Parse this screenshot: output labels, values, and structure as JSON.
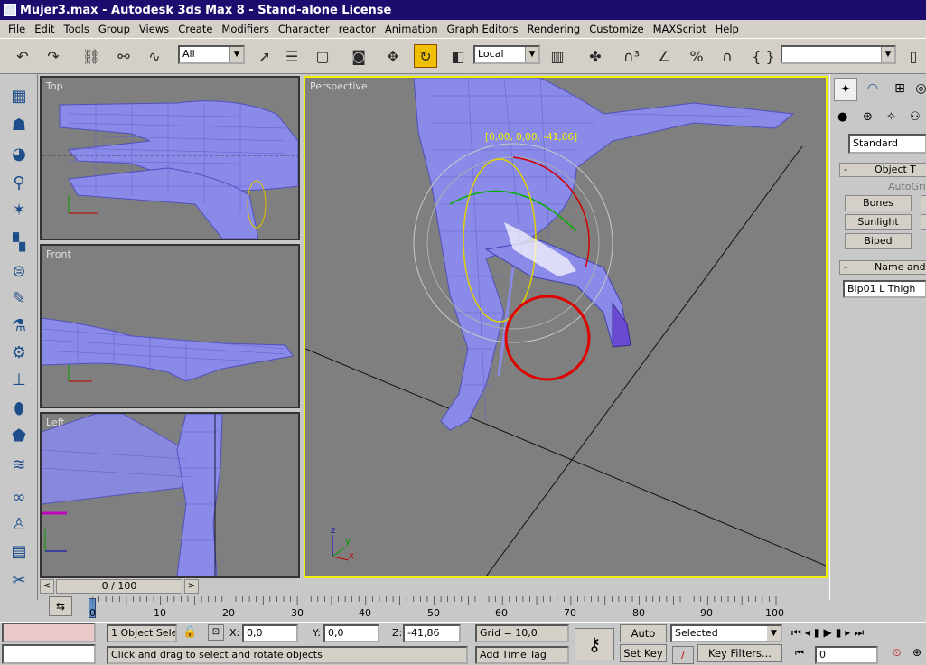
{
  "window": {
    "title": "Mujer3.max - Autodesk 3ds Max 8  - Stand-alone License"
  },
  "menu": [
    "File",
    "Edit",
    "Tools",
    "Group",
    "Views",
    "Create",
    "Modifiers",
    "Character",
    "reactor",
    "Animation",
    "Graph Editors",
    "Rendering",
    "Customize",
    "MAXScript",
    "Help"
  ],
  "toolbar": {
    "selection_filter": "All",
    "coord_system": "Local",
    "named_selection": ""
  },
  "viewports": {
    "top": "Top",
    "front": "Front",
    "left": "Left",
    "perspective": "Perspective",
    "coord_readout": "[0,00, 0,00, -41,86]",
    "axes": {
      "x": "x",
      "y": "y",
      "z": "z"
    }
  },
  "command_panel": {
    "category": "Standard",
    "rollout_object_type": "Object T",
    "autogrid": "AutoGric",
    "btn_bones": "Bones",
    "btn_sunlight": "Sunlight",
    "btn_biped": "Biped",
    "rollout_name": "Name and",
    "object_name": "Bip01 L Thigh",
    "minus": "-"
  },
  "time_slider": {
    "label": "0 / 100",
    "prev": "<",
    "next": ">"
  },
  "track_ticks": [
    "0",
    "10",
    "20",
    "30",
    "40",
    "50",
    "60",
    "70",
    "80",
    "90",
    "100"
  ],
  "status": {
    "selection_count": "1 Object Sele",
    "x_label": "X:",
    "x_value": "0,0",
    "y_label": "Y:",
    "y_value": "0,0",
    "z_label": "Z:",
    "z_value": "-41,86",
    "grid": "Grid = 10,0",
    "prompt": "Click and drag to select and rotate objects",
    "add_time_tag": "Add Time Tag",
    "auto_key": "Auto Key",
    "set_key": "Set Key",
    "key_mode": "Selected",
    "key_filters": "Key Filters...",
    "frame": "0"
  },
  "colors": {
    "title_bg": "#1c0c6e",
    "active_viewport": "#f0f000",
    "wire": "#8a8ae8",
    "highlight_circle": "#e00000"
  }
}
